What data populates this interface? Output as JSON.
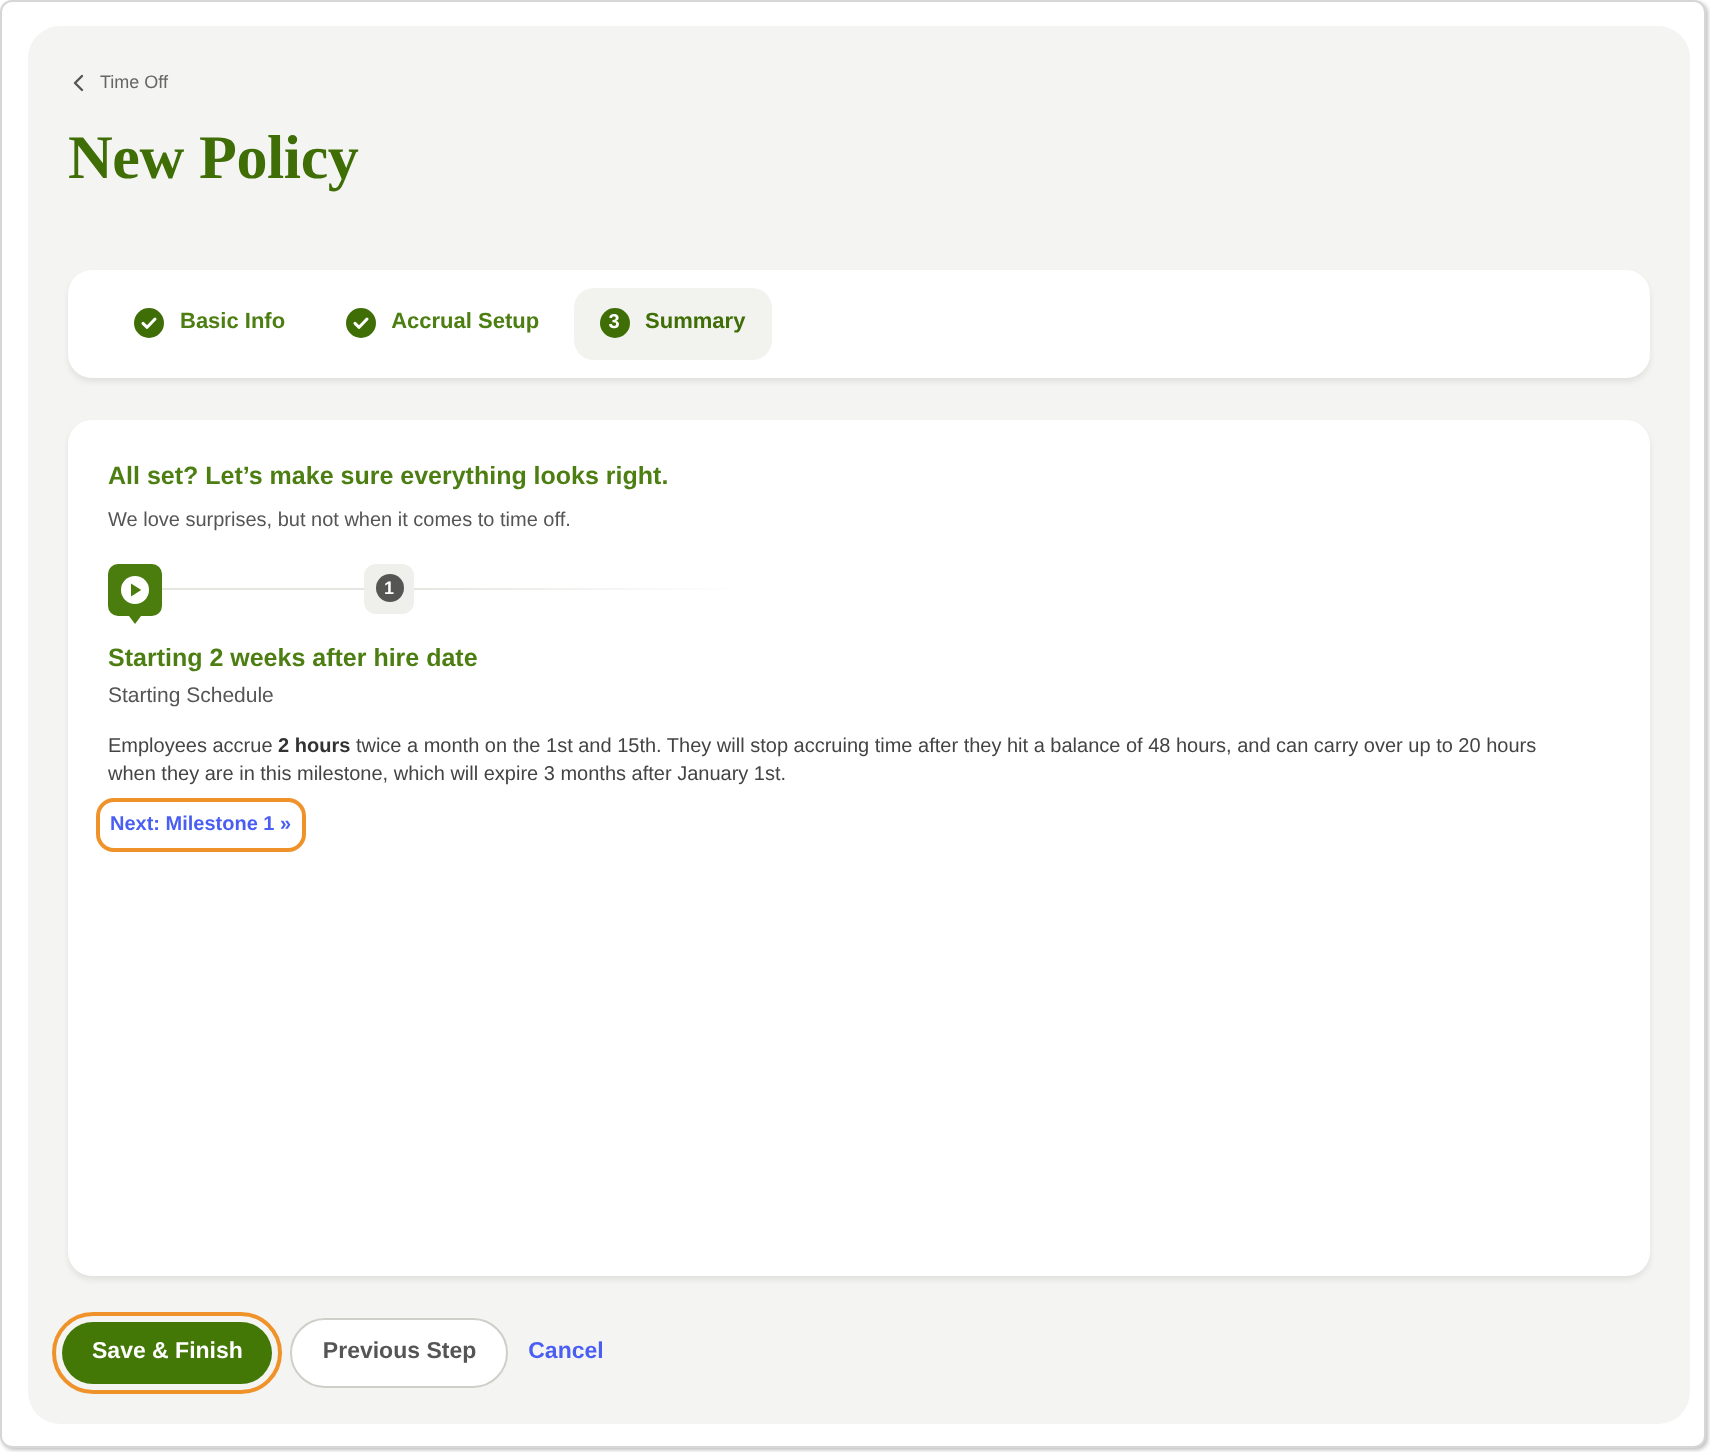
{
  "breadcrumb": {
    "label": "Time Off"
  },
  "page_title": "New Policy",
  "steps": [
    {
      "label": "Basic Info",
      "completed": true,
      "selected": false
    },
    {
      "label": "Accrual Setup",
      "completed": true,
      "selected": false
    },
    {
      "label": "Summary",
      "number": "3",
      "completed": false,
      "selected": true
    }
  ],
  "summary": {
    "heading": "All set? Let’s make sure everything looks right.",
    "subheading": "We love surprises, but not when it comes to time off.",
    "milestones": [
      {
        "kind": "start",
        "selected": true
      },
      {
        "kind": "milestone",
        "number": "1",
        "selected": false
      }
    ],
    "title": "Starting 2 weeks after hire date",
    "subtitle": "Starting Schedule",
    "description": "Employees accrue **2 hours** twice a month on the 1st and 15th. They will stop accruing time after they hit a balance of 48 hours, and can carry over up to 20 hours when they are in this milestone, which will expire 3 months after January 1st.",
    "next_link": {
      "label": "Next: Milestone 1 »",
      "focused": true
    }
  },
  "footer_buttons": [
    {
      "kind": "primary",
      "label": "Save & Finish",
      "focused": true
    },
    {
      "kind": "secondary",
      "label": "Previous Step",
      "focused": false
    },
    {
      "kind": "link",
      "label": "Cancel",
      "focused": false
    }
  ]
}
